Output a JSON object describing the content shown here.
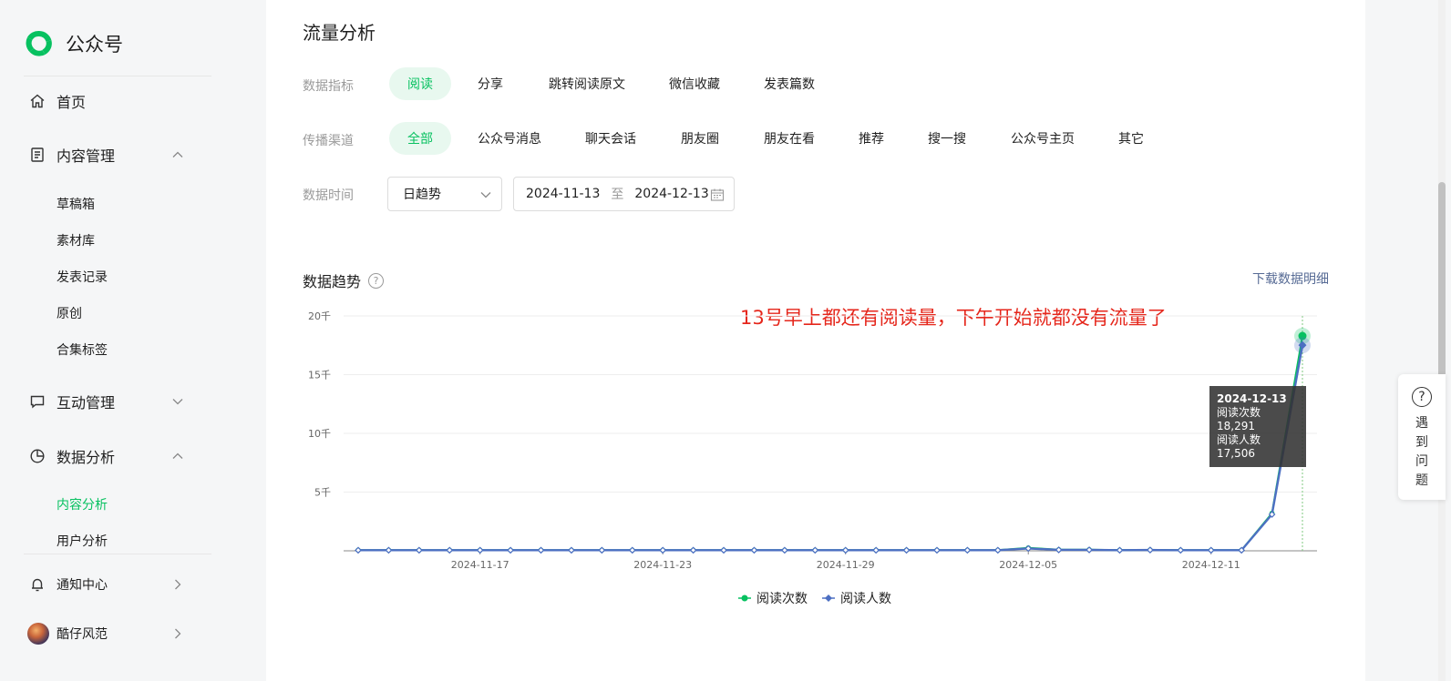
{
  "sidebar": {
    "brand": "公众号",
    "home": "首页",
    "content_mgmt": "内容管理",
    "content_sub": [
      "草稿箱",
      "素材库",
      "发表记录",
      "原创",
      "合集标签"
    ],
    "interaction_mgmt": "互动管理",
    "data_analysis": "数据分析",
    "data_sub": [
      "内容分析",
      "用户分析"
    ],
    "notifications": "通知中心",
    "user_name": "酷仔风范"
  },
  "main": {
    "section_title": "流量分析",
    "metric_label": "数据指标",
    "metrics": [
      "阅读",
      "分享",
      "跳转阅读原文",
      "微信收藏",
      "发表篇数"
    ],
    "channel_label": "传播渠道",
    "channels": [
      "全部",
      "公众号消息",
      "聊天会话",
      "朋友圈",
      "朋友在看",
      "推荐",
      "搜一搜",
      "公众号主页",
      "其它"
    ],
    "time_label": "数据时间",
    "granularity": "日趋势",
    "date_start": "2024-11-13",
    "date_sep": "至",
    "date_end": "2024-12-13",
    "trend_title": "数据趋势",
    "download": "下载数据明细",
    "annotation": "13号早上都还有阅读量，下午开始就都没有流量了"
  },
  "chart_data": {
    "type": "line",
    "x": [
      "2024-11-13",
      "2024-11-14",
      "2024-11-15",
      "2024-11-16",
      "2024-11-17",
      "2024-11-18",
      "2024-11-19",
      "2024-11-20",
      "2024-11-21",
      "2024-11-22",
      "2024-11-23",
      "2024-11-24",
      "2024-11-25",
      "2024-11-26",
      "2024-11-27",
      "2024-11-28",
      "2024-11-29",
      "2024-11-30",
      "2024-12-01",
      "2024-12-02",
      "2024-12-03",
      "2024-12-04",
      "2024-12-05",
      "2024-12-06",
      "2024-12-07",
      "2024-12-08",
      "2024-12-09",
      "2024-12-10",
      "2024-12-11",
      "2024-12-12",
      "2024-12-13"
    ],
    "x_ticks": [
      "2024-11-17",
      "2024-11-23",
      "2024-11-29",
      "2024-12-05",
      "2024-12-11"
    ],
    "y_ticks": [
      "5千",
      "10千",
      "15千",
      "20千"
    ],
    "ylim": [
      0,
      20000
    ],
    "series": [
      {
        "name": "阅读次数",
        "color": "#07c160",
        "values": [
          60,
          60,
          60,
          60,
          60,
          60,
          60,
          60,
          60,
          60,
          60,
          60,
          60,
          60,
          60,
          60,
          60,
          60,
          60,
          60,
          60,
          60,
          250,
          100,
          100,
          60,
          80,
          60,
          60,
          60,
          3200,
          18291
        ]
      },
      {
        "name": "阅读人数",
        "color": "#4c6fc2",
        "values": [
          50,
          50,
          50,
          50,
          50,
          50,
          50,
          50,
          50,
          50,
          50,
          50,
          50,
          50,
          50,
          50,
          50,
          50,
          50,
          50,
          50,
          50,
          200,
          80,
          80,
          50,
          70,
          50,
          50,
          50,
          3100,
          17506
        ]
      }
    ],
    "tooltip": {
      "date": "2024-12-13",
      "line1": "阅读次数 18,291",
      "line2": "阅读人数 17,506"
    },
    "grid": true,
    "legend": "bottom-center"
  },
  "help_widget": {
    "text": "遇到问题"
  }
}
